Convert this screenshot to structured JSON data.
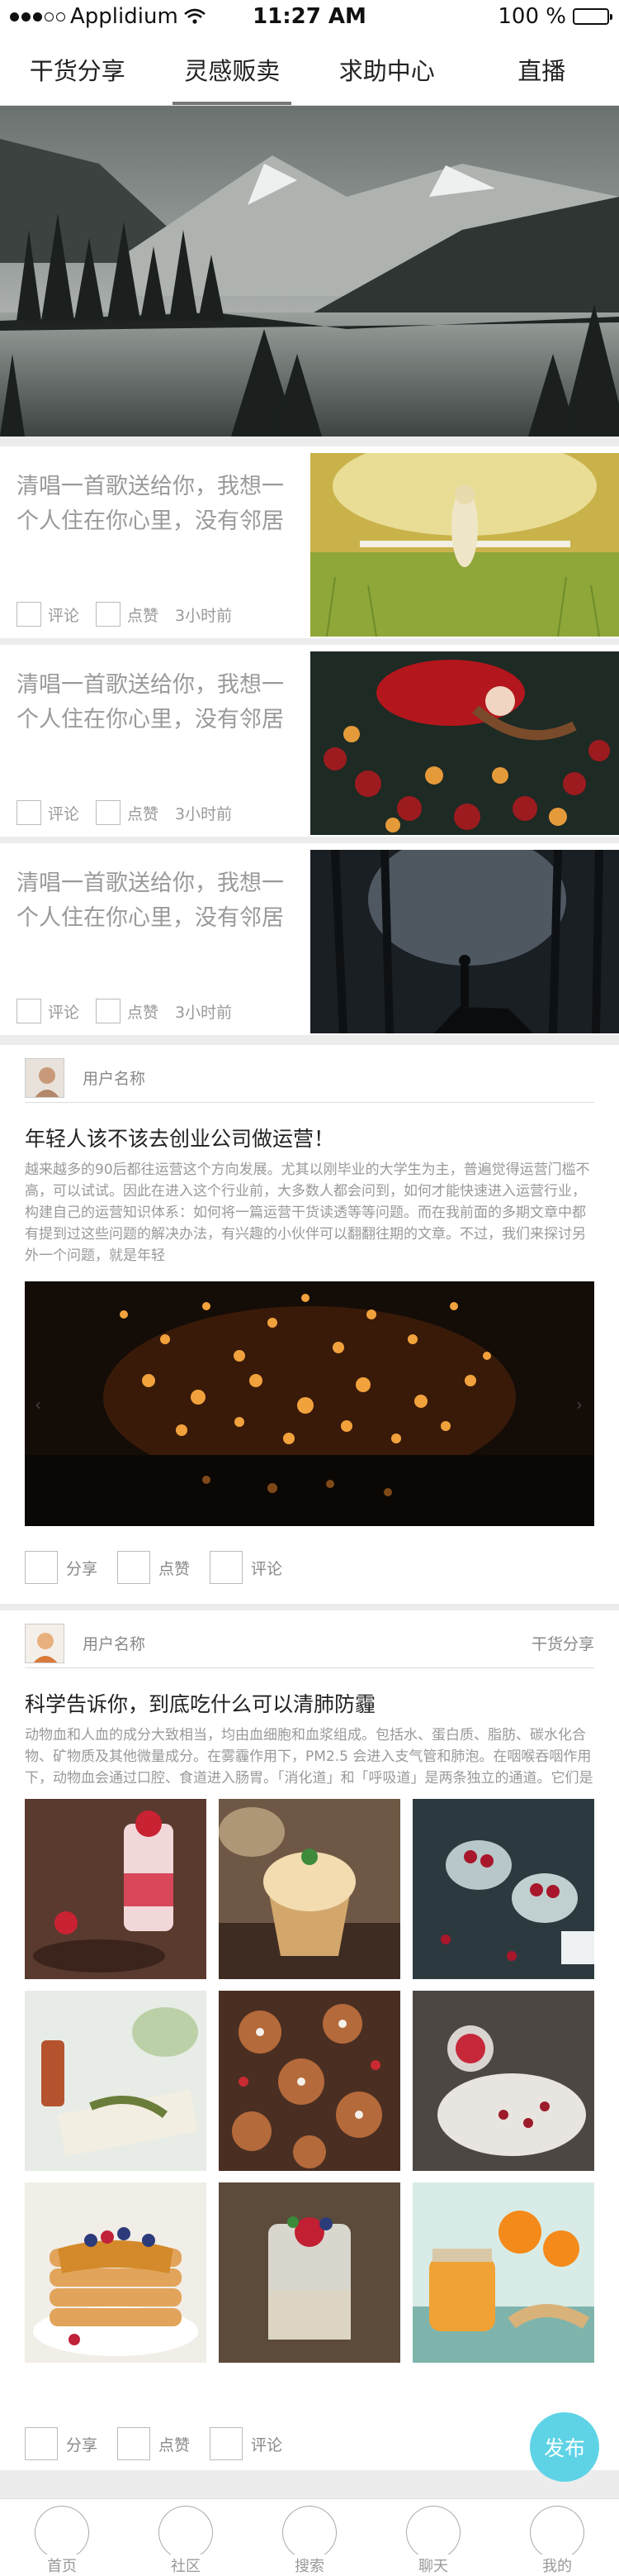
{
  "status_bar": {
    "carrier": "Applidium",
    "time": "11:27 AM",
    "battery": "100 %",
    "battery_level": 1.0,
    "signal_bars_filled": 3,
    "signal_bars_total": 5
  },
  "tabs": [
    {
      "label": "干货分享",
      "active": false
    },
    {
      "label": "灵感贩卖",
      "active": true
    },
    {
      "label": "求助中心",
      "active": false
    },
    {
      "label": "直播",
      "active": false
    }
  ],
  "articles": [
    {
      "text": "清唱一首歌送给你，我想一个人住在你心里，没有邻居",
      "comment": "评论",
      "like": "点赞",
      "time": "3小时前",
      "image": "girl-in-field-photo"
    },
    {
      "text": "清唱一首歌送给你，我想一个人住在你心里，没有邻居",
      "comment": "评论",
      "like": "点赞",
      "time": "3小时前",
      "image": "woman-with-roses-photo"
    },
    {
      "text": "清唱一首歌送给你，我想一个人住在你心里，没有邻居",
      "comment": "评论",
      "like": "点赞",
      "time": "3小时前",
      "image": "man-in-misty-forest-photo"
    }
  ],
  "post1": {
    "username": "用户名称",
    "title": "年轻人该不该去创业公司做运营！",
    "body": "越来越多的90后都往运营这个方向发展。尤其以刚毕业的大学生为主，普遍觉得运营门槛不高，可以试试。因此在进入这个行业前，大多数人都会问到，如何才能快速进入运营行业，构建自己的运营知识体系：如何将一篇运营干货读透等等问题。而在我前面的多期文章中都有提到过这些问题的解决办法，有兴趣的小伙伴可以翻翻往期的文章。不过，我们来探讨另外一个问题，就是年轻",
    "image": "sky-lanterns-photo",
    "actions": [
      "分享",
      "点赞",
      "评论"
    ]
  },
  "post2": {
    "username": "用户名称",
    "category": "干货分享",
    "title": "科学告诉你，到底吃什么可以清肺防霾",
    "body": "动物血和人血的成分大致相当，均由血细胞和血浆组成。包括水、蛋白质、脂肪、碳水化合物、矿物质及其他微量成分。在雾霾作用下，PM2.5 会进入支气管和肺泡。在咽喉吞咽作用下，动物血会通过口腔、食道进入肠胃。「消化道」和「呼吸道」是两条独立的通道。它们是不会相通的啊！消化道的东西怎么会跑呼吸道里打扫卫生啊？动物血没有能力跨越时空去吸附呼吸道的粉尘啊...",
    "images": [
      "strawberry-dessert-photo",
      "cupcake-photo",
      "berry-cups-photo",
      "book-and-bottle-photo",
      "gingerbread-cookies-photo",
      "dessert-plate-photo",
      "berry-pancakes-photo",
      "chia-pudding-photo",
      "orange-jam-photo"
    ],
    "actions": [
      "分享",
      "点赞",
      "评论"
    ]
  },
  "publish_button": "发布",
  "bottom_nav": [
    "首页",
    "社区",
    "搜索",
    "聊天",
    "我的"
  ]
}
